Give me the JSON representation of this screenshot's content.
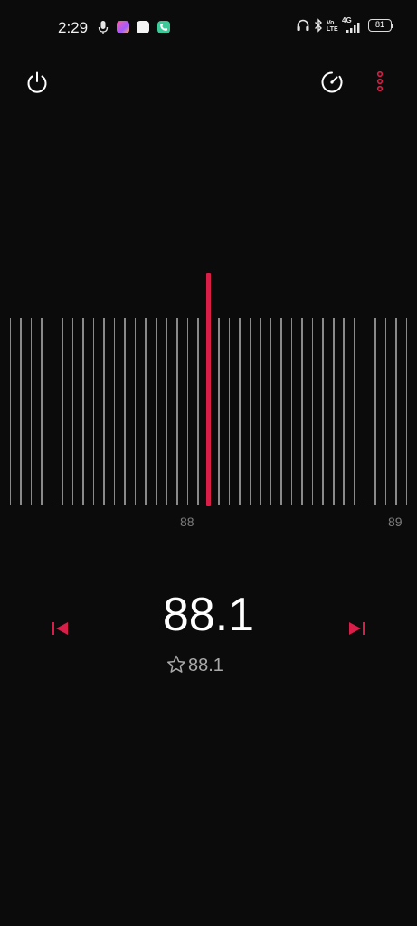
{
  "status_bar": {
    "time": "2:29",
    "network_label": "4G",
    "volte_label": "Vo LTE",
    "battery_level": "81"
  },
  "toolbar": {
    "power_icon": "power-icon",
    "speed_icon": "speedometer-icon",
    "more_icon": "more-vertical-icon"
  },
  "dial": {
    "labels": [
      "88",
      "89"
    ],
    "needle_color": "#d81e49",
    "tick_color": "#8a8a8a"
  },
  "tuner": {
    "frequency": "88.1",
    "favorite_frequency": "88.1",
    "prev_icon": "skip-previous-icon",
    "next_icon": "skip-next-icon",
    "favorite_icon": "star-outline-icon"
  },
  "colors": {
    "background": "#0b0b0b",
    "accent": "#d81e49"
  }
}
